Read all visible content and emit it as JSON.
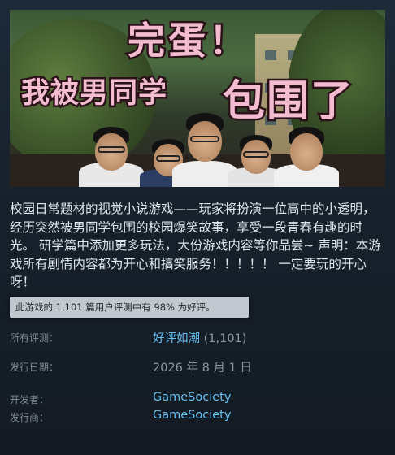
{
  "capsule": {
    "title_line1": "完蛋！",
    "title_line2": "我被男同学",
    "title_line3": "包围了"
  },
  "description": "校园日常题材的视觉小说游戏——玩家将扮演一位高中的小透明，经历突然被男同学包围的校园爆笑故事，享受一段青春有趣的时光。 研学篇中添加更多玩法，大份游戏内容等你品尝~ 声明：本游戏所有剧情内容都为开心和搞笑服务！！！！！ 一定要玩的开心呀！",
  "tooltip": "此游戏的 1,101 篇用户评测中有 98% 为好评。",
  "reviews": {
    "label": "所有评测：",
    "summary": "好评如潮",
    "count": "(1,101)"
  },
  "release": {
    "label": "发行日期：",
    "date": "2026 年 8 月 1 日"
  },
  "developer": {
    "label": "开发者：",
    "name": "GameSociety"
  },
  "publisher": {
    "label": "发行商：",
    "name": "GameSociety"
  },
  "colors": {
    "link": "#66c0f4",
    "label": "#7f8b96",
    "title_pink": "#f4bcd0"
  }
}
